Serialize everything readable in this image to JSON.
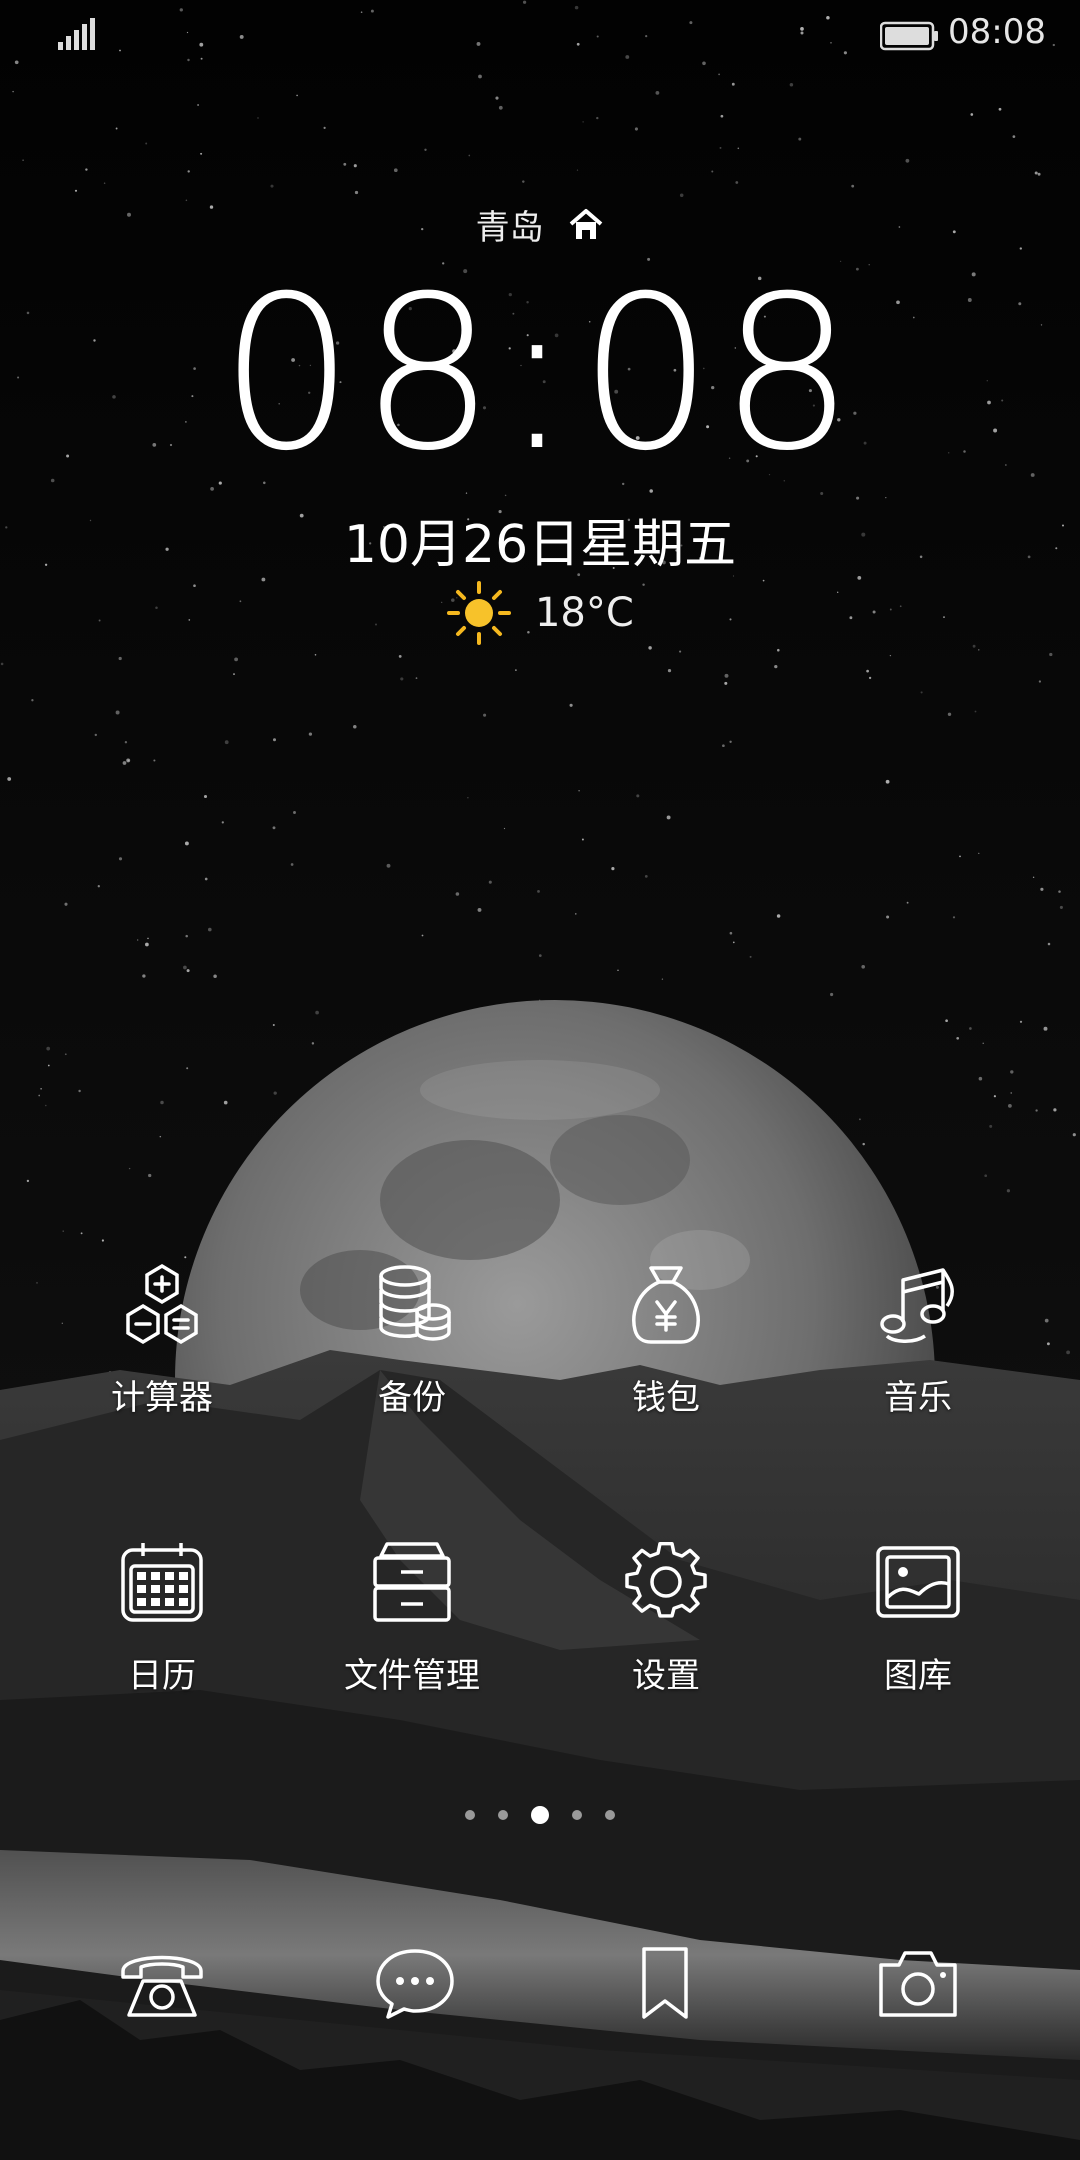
{
  "status_bar": {
    "time": "08:08",
    "signal_icon": "signal-icon",
    "battery_icon": "battery-icon"
  },
  "lockscreen": {
    "city": "青岛",
    "clock": "08:08",
    "date": "10月26日星期五",
    "weather": {
      "icon": "sun-icon",
      "temperature": "18°C"
    }
  },
  "apps_row1": [
    {
      "label": "计算器",
      "icon": "calculator-icon"
    },
    {
      "label": "备份",
      "icon": "backup-icon"
    },
    {
      "label": "钱包",
      "icon": "wallet-icon"
    },
    {
      "label": "音乐",
      "icon": "music-icon"
    }
  ],
  "apps_row2": [
    {
      "label": "日历",
      "icon": "calendar-icon"
    },
    {
      "label": "文件管理",
      "icon": "file-manager-icon"
    },
    {
      "label": "设置",
      "icon": "settings-icon"
    },
    {
      "label": "图库",
      "icon": "gallery-icon"
    }
  ],
  "page_indicator": {
    "pages": 5,
    "current": 3
  },
  "dock": [
    {
      "icon": "phone-icon"
    },
    {
      "icon": "messages-icon"
    },
    {
      "icon": "bookmark-icon"
    },
    {
      "icon": "camera-icon"
    }
  ]
}
